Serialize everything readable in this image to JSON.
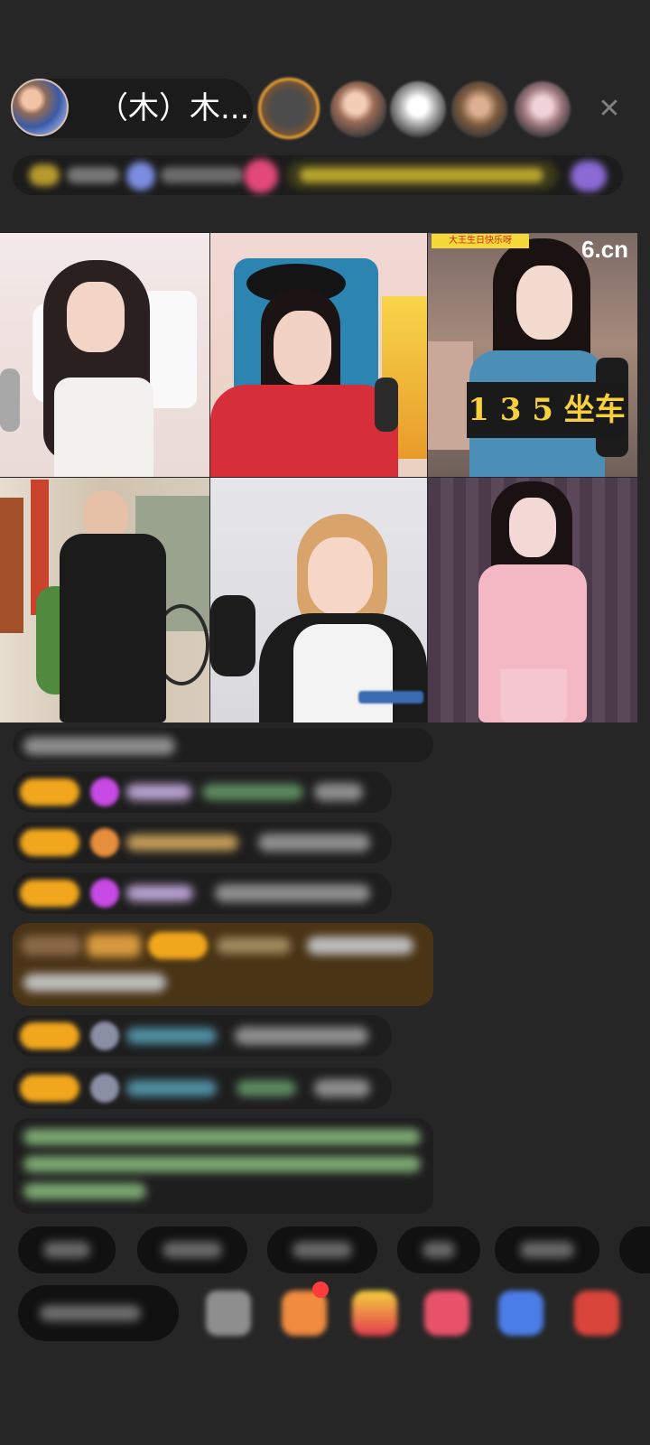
{
  "host": {
    "name": "（木）木...",
    "avatar_icon": "host-avatar-icon"
  },
  "viewers": [
    "viewer-avatar-1",
    "viewer-avatar-2",
    "viewer-avatar-3",
    "viewer-avatar-4",
    "viewer-avatar-5"
  ],
  "close_icon": "✕",
  "streams": [
    {
      "id": "stream-1"
    },
    {
      "id": "stream-2"
    },
    {
      "id": "stream-3",
      "banner": "大王生日快乐呀",
      "logo": "6.cn",
      "overlay": "1 3 5 坐车"
    },
    {
      "id": "stream-4"
    },
    {
      "id": "stream-5"
    },
    {
      "id": "stream-6"
    }
  ],
  "colors": {
    "background": "#262626",
    "level_badge": "#f1a71d",
    "overlay_text": "#f6d13d",
    "notification_dot": "#ff3b3b"
  }
}
